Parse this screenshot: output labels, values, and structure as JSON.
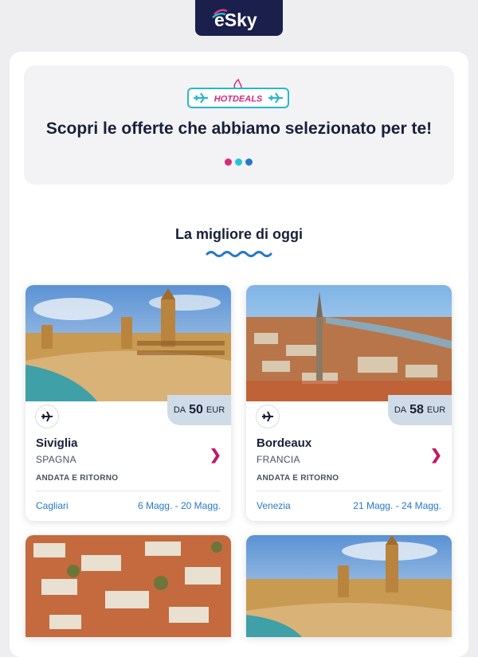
{
  "brand": {
    "logo": "eSky",
    "badge": "HOTDEALS"
  },
  "hero": {
    "title": "Scopri le offerte che abbiamo selezionato per te!"
  },
  "section": {
    "title": "La migliore di oggi"
  },
  "colors": {
    "navy": "#1a1f4b",
    "accent_pink": "#c01a6a",
    "teal": "#29b6d0",
    "link_blue": "#2878c8"
  },
  "deals": [
    {
      "price_prefix": "DA",
      "price": "50",
      "currency": "EUR",
      "city": "Siviglia",
      "country": "SPAGNA",
      "trip_type": "ANDATA E RITORNO",
      "origin": "Cagliari",
      "dates": "6 Magg. - 20 Magg.",
      "icon": "plane-icon"
    },
    {
      "price_prefix": "DA",
      "price": "58",
      "currency": "EUR",
      "city": "Bordeaux",
      "country": "FRANCIA",
      "trip_type": "ANDATA E RITORNO",
      "origin": "Venezia",
      "dates": "21 Magg. - 24 Magg.",
      "icon": "plane-icon"
    }
  ]
}
